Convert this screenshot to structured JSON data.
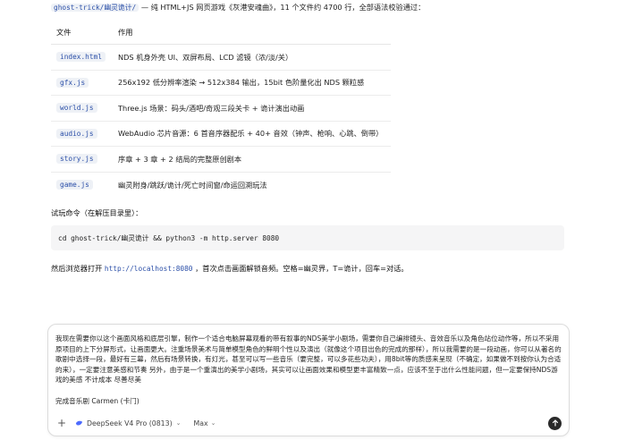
{
  "intro": {
    "path": "ghost-trick/幽灵诡计/",
    "text": " — 纯 HTML+JS 网页游戏《灰港安魂曲》，11 个文件约 4700 行，全部语法校验通过："
  },
  "table": {
    "headers": [
      "文件",
      "作用"
    ],
    "rows": [
      {
        "file": "index.html",
        "desc": "NDS 机身外壳 UI、双屏布局、LCD 滤镜（浓/淡/关）"
      },
      {
        "file": "gfx.js",
        "desc": "256x192 低分辨率渲染 → 512x384 输出，15bit 色阶量化出 NDS 颗粒感"
      },
      {
        "file": "world.js",
        "desc": "Three.js 场景：码头/酒吧/奇观三段关卡 + 诡计演出动画"
      },
      {
        "file": "audio.js",
        "desc": "WebAudio 芯片音源：6 首音序器配乐 + 40+ 音效（钟声、枪响、心跳、倒带）"
      },
      {
        "file": "story.js",
        "desc": "序章 + 3 章 + 2 结局的完整原创剧本"
      },
      {
        "file": "game.js",
        "desc": "幽灵附身/跳跃/诡计/死亡时间窗/命运回溯玩法"
      }
    ]
  },
  "trial": {
    "label": "试玩命令（在解压目录里）：",
    "command": "cd ghost-trick/幽灵诡计 && python3 -m http.server 8080"
  },
  "open_line": {
    "prefix": "然后浏览器打开 ",
    "link": "http://localhost:8080",
    "suffix": " ，首次点击画面解锁音频。空格=幽灵界，T=诡计，回车=对话。"
  },
  "composer": {
    "text": "我现在需要你以这个画面风格和底层引擎，制作一个适合电脑屏幕观看的带有叙事的NDS美学小剧场，需要你自己编排镜头、音效音乐以及角色站位动作等，所以不采用原项目的上下分屏形式，让画面更大。注重场景美术与简单模型角色的鲜明个性以及演出（就像这个项目出色的完成的那样），所以我需要的是一段动画，你可以从著名的歌剧中选择一段，最好有三幕，然后有场景转换，有灯光，甚至可以写一些音乐（要完整，可以多花些功夫），用8bit等的质感来呈现（不确定，如果做不到按你认为合适的来），一定要注意美感和节奏 另外，由于是一个重演出的美学小剧场，其实可以让画面效果和模型更丰富精致一点，应该不至于出什么性能问题，但一定要保持NDS游戏的美感 不计成本 尽善尽美\n\n完成音乐剧 Carmen (卡门)",
    "model": "DeepSeek V4 Pro (0813)",
    "mode": "Max",
    "plus_icon": "plus-icon",
    "send_icon": "arrow-up-icon"
  }
}
